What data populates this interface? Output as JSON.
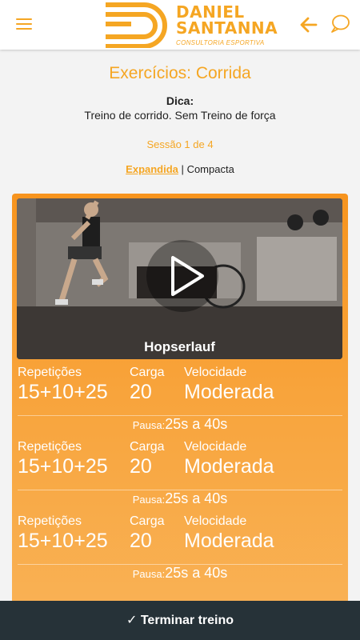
{
  "header": {
    "logo_line1": "DANIEL",
    "logo_line2": "SANTANNA",
    "logo_sub": "CONSULTORIA ESPORTIVA",
    "menu_icon": "hamburger-icon",
    "back_icon": "arrow-left-icon",
    "chat_icon": "chat-bubble-icon"
  },
  "page": {
    "title": "Exercícios: Corrida",
    "tip_label": "Dica:",
    "tip_text": "Treino de corrido. Sem Treino de força",
    "session": "Sessão 1 de 4",
    "view_expanded": "Expandida",
    "view_separator": "|",
    "view_compact": "Compacta"
  },
  "exercise": {
    "name": "Hopserlauf",
    "play_icon": "play-icon",
    "sets": [
      {
        "rep_label": "Repetições",
        "rep_value": "15+10+25",
        "load_label": "Carga",
        "load_value": "20",
        "speed_label": "Velocidade",
        "speed_value": "Moderada",
        "pause_label": "Pausa:",
        "pause_value": "25s a 40s"
      },
      {
        "rep_label": "Repetições",
        "rep_value": "15+10+25",
        "load_label": "Carga",
        "load_value": "20",
        "speed_label": "Velocidade",
        "speed_value": "Moderada",
        "pause_label": "Pausa:",
        "pause_value": "25s a 40s"
      },
      {
        "rep_label": "Repetições",
        "rep_value": "15+10+25",
        "load_label": "Carga",
        "load_value": "20",
        "speed_label": "Velocidade",
        "speed_value": "Moderada",
        "pause_label": "Pausa:",
        "pause_value": "25s a 40s"
      }
    ]
  },
  "footer": {
    "finish_label": "✓ Terminar treino"
  },
  "colors": {
    "accent": "#f5a623",
    "card_top": "#f7941e",
    "card_bottom": "#f9b358",
    "bottom_bar": "#263238"
  }
}
